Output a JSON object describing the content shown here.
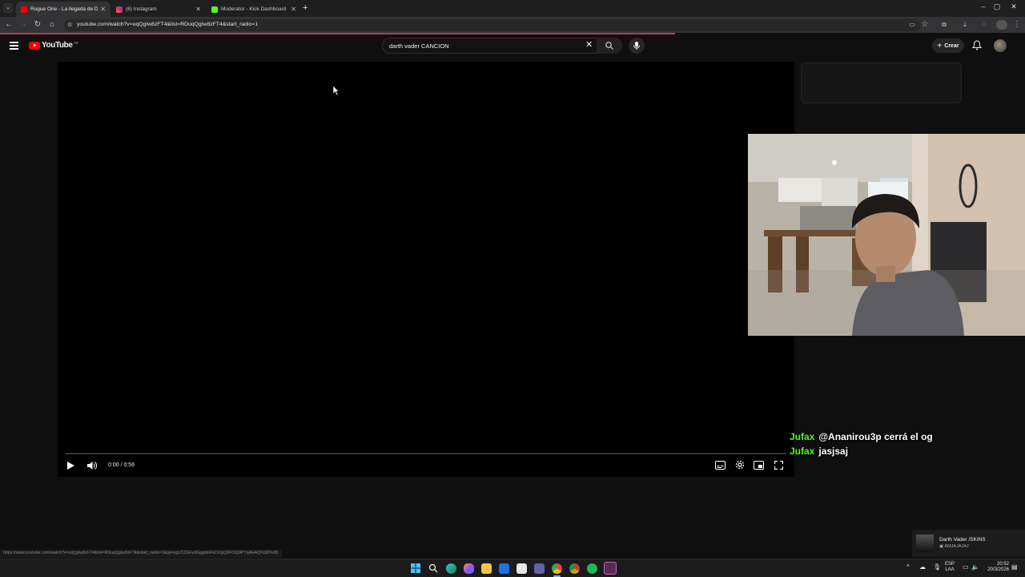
{
  "browser": {
    "tabs": [
      {
        "label": "Rogue One - La llegada de Dar",
        "favicon_color": "#ff0000",
        "active": true
      },
      {
        "label": "(6) Instagram",
        "favicon_color": "#d6249f",
        "active": false
      },
      {
        "label": "Moderator - Kick Dashboard",
        "favicon_color": "#53fc18",
        "active": false
      }
    ],
    "url": "youtube.com/watch?v=uqQgIw8zFT4&list=RDuqQgIw8zFT4&start_radio=1",
    "new_tab_symbol": "+"
  },
  "youtube": {
    "logo_text": "YouTube",
    "country_code": "AR",
    "search_value": "darth vader CANCION",
    "create_label": "Crear"
  },
  "player": {
    "time": "0:00 / 0:56",
    "progress_fraction": 0.0
  },
  "chat": [
    {
      "user": "Jufax",
      "message": "@Ananirou3p cerrá el og"
    },
    {
      "user": "Jufax",
      "message": "jasjsaj"
    }
  ],
  "status_bar_url": "https://www.youtube.com/watch?v=uqQgIw8zFT4&list=RDuqQgIw8zFT4&start_radio=1&pp=ygUTZGFydGggdmFkZXIgQ0FOQ0lPTqAHAQ%3D%3D",
  "now_playing": {
    "title": "Darth Vader /SKINS",
    "subtitle": "AMJAJAJAJ"
  },
  "taskbar": {
    "lang_top": "ESP",
    "lang_bottom": "LAA",
    "time": "20:52",
    "date": "20/3/2026"
  },
  "colors": {
    "accent_red": "#ff0000",
    "kick_green": "#53fc18",
    "background": "#0f0f0f"
  }
}
